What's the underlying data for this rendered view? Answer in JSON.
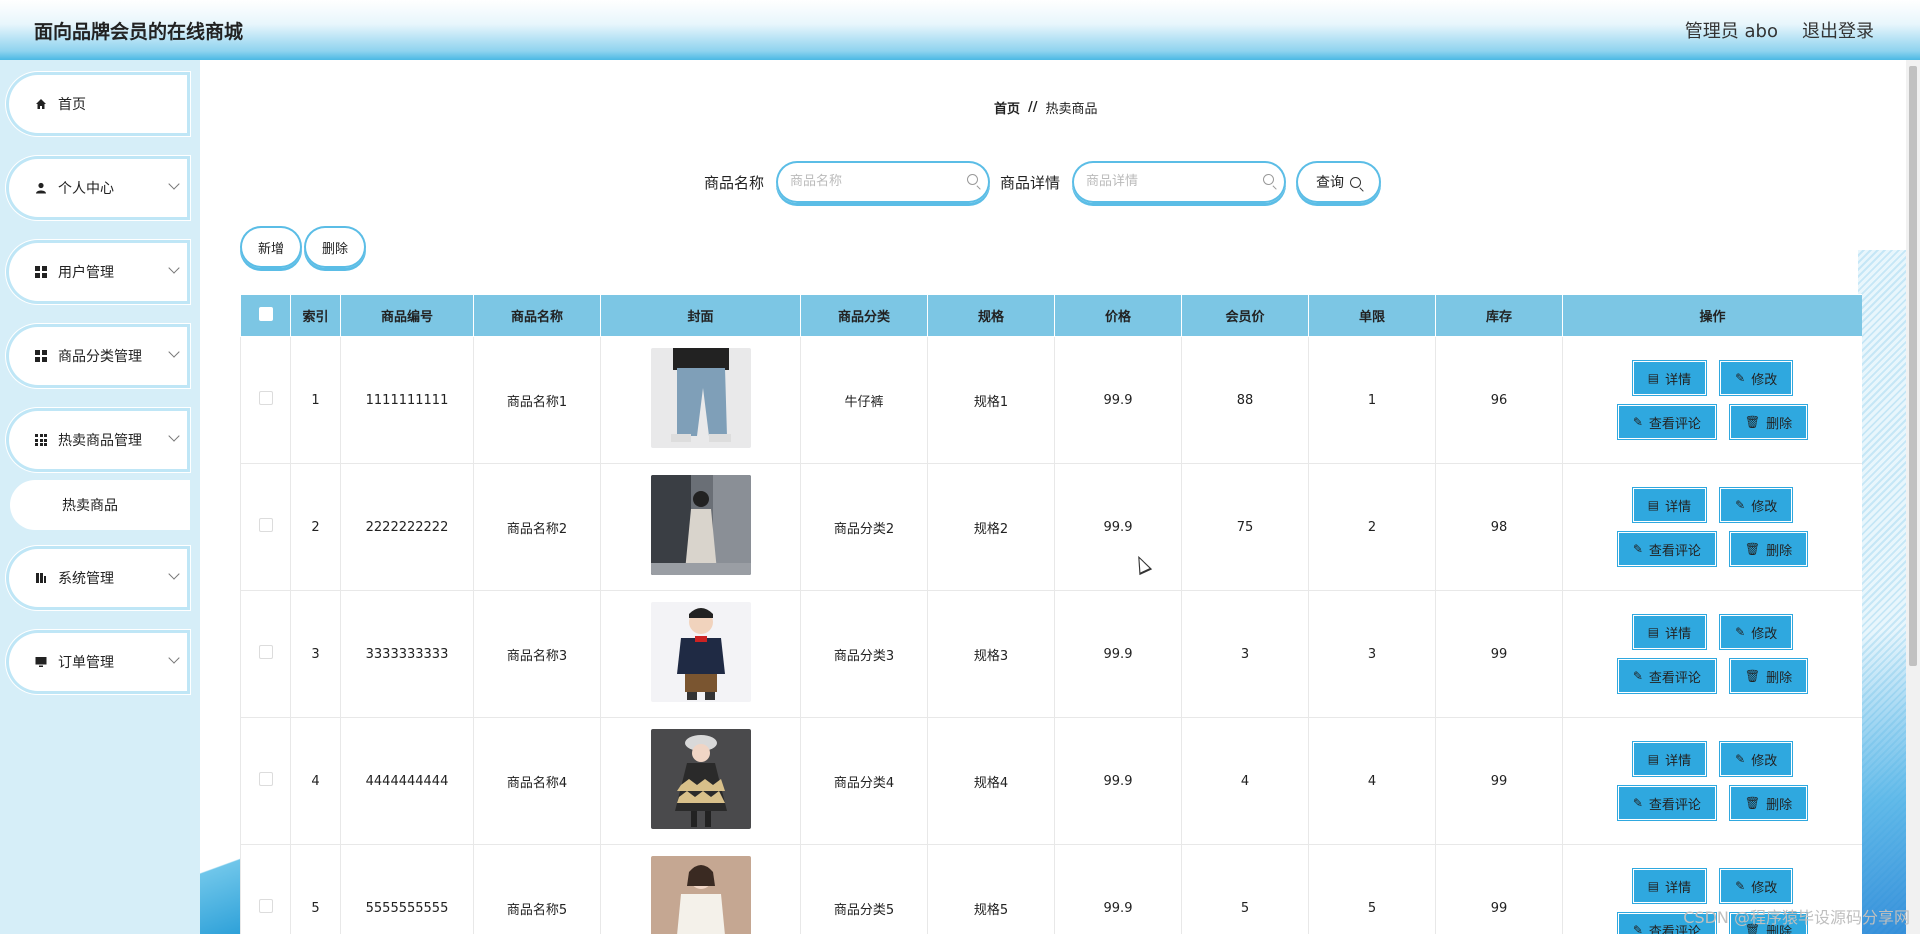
{
  "header": {
    "title": "面向品牌会员的在线商城",
    "user": "管理员 abo",
    "logout": "退出登录"
  },
  "sidebar": {
    "items": [
      {
        "label": "首页",
        "icon": "home-icon"
      },
      {
        "label": "个人中心",
        "icon": "user-icon"
      },
      {
        "label": "用户管理",
        "icon": "grid-icon"
      },
      {
        "label": "商品分类管理",
        "icon": "grid-icon"
      },
      {
        "label": "热卖商品管理",
        "icon": "apps-icon"
      },
      {
        "label": "系统管理",
        "icon": "chart-icon"
      },
      {
        "label": "订单管理",
        "icon": "monitor-icon"
      }
    ],
    "sub_item": "热卖商品"
  },
  "breadcrumb": {
    "home": "首页",
    "separator": "//",
    "current": "热卖商品"
  },
  "search": {
    "name_label": "商品名称",
    "name_placeholder": "商品名称",
    "detail_label": "商品详情",
    "detail_placeholder": "商品详情",
    "query_button": "查询"
  },
  "toolbar": {
    "add": "新增",
    "delete": "删除"
  },
  "table": {
    "headers": [
      "索引",
      "商品编号",
      "商品名称",
      "封面",
      "商品分类",
      "规格",
      "价格",
      "会员价",
      "单限",
      "库存",
      "操作"
    ],
    "rows": [
      {
        "index": "1",
        "code": "1111111111",
        "name": "商品名称1",
        "category": "牛仔裤",
        "spec": "规格1",
        "price": "99.9",
        "member_price": "88",
        "limit": "1",
        "stock": "96"
      },
      {
        "index": "2",
        "code": "2222222222",
        "name": "商品名称2",
        "category": "商品分类2",
        "spec": "规格2",
        "price": "99.9",
        "member_price": "75",
        "limit": "2",
        "stock": "98"
      },
      {
        "index": "3",
        "code": "3333333333",
        "name": "商品名称3",
        "category": "商品分类3",
        "spec": "规格3",
        "price": "99.9",
        "member_price": "3",
        "limit": "3",
        "stock": "99"
      },
      {
        "index": "4",
        "code": "4444444444",
        "name": "商品名称4",
        "category": "商品分类4",
        "spec": "规格4",
        "price": "99.9",
        "member_price": "4",
        "limit": "4",
        "stock": "99"
      },
      {
        "index": "5",
        "code": "5555555555",
        "name": "商品名称5",
        "category": "商品分类5",
        "spec": "规格5",
        "price": "99.9",
        "member_price": "5",
        "limit": "5",
        "stock": "99"
      }
    ],
    "ops": {
      "detail": "详情",
      "edit": "修改",
      "comments": "查看评论",
      "delete": "删除"
    }
  },
  "watermark": "CSDN @程序猿毕设源码分享网",
  "colors": {
    "accent": "#2fa8df",
    "header_row": "#7cc6e4",
    "sidebar_bg": "#d6eef8"
  }
}
